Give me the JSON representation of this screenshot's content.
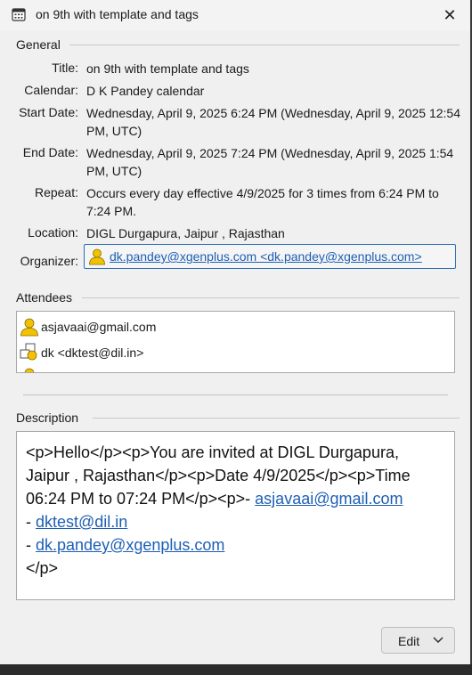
{
  "window": {
    "title": "on 9th with template and tags",
    "close_glyph": "✕"
  },
  "general": {
    "heading": "General",
    "title_label": "Title:",
    "title_value": "on 9th with template and tags",
    "calendar_label": "Calendar:",
    "calendar_value": "D K Pandey calendar",
    "start_label": "Start Date:",
    "start_value": "Wednesday, April 9, 2025 6:24 PM (Wednesday, April 9, 2025 12:54 PM, UTC)",
    "end_label": "End Date:",
    "end_value": "Wednesday, April 9, 2025 7:24 PM (Wednesday, April 9, 2025 1:54 PM, UTC)",
    "repeat_label": "Repeat:",
    "repeat_value": "Occurs every day effective 4/9/2025 for 3 times from 6:24 PM to 7:24 PM.",
    "location_label": "Location:",
    "location_value": "DIGL Durgapura, Jaipur , Rajasthan",
    "organizer_label": "Organizer:",
    "organizer_value": "dk.pandey@xgenplus.com <dk.pandey@xgenplus.com>"
  },
  "attendees": {
    "heading": "Attendees",
    "items": [
      {
        "label": "asjavaai@gmail.com",
        "icon": "person-icon"
      },
      {
        "label": "dk <dktest@dil.in>",
        "icon": "person-pending-icon"
      }
    ]
  },
  "description": {
    "heading": "Description",
    "line1": "<p>Hello</p><p>You are invited at DIGL Durgapura,",
    "line2": "Jaipur , Rajasthan</p><p>Date 4/9/2025</p><p>Time",
    "line3_text": "06:24 PM to 07:24 PM</p><p>- ",
    "line3_link": "asjavaai@gmail.com",
    "line4_prefix": "- ",
    "line4_link": "dktest@dil.in",
    "line5_prefix": "- ",
    "line5_link": "dk.pandey@xgenplus.com",
    "line6": "</p>"
  },
  "footer": {
    "edit_label": "Edit"
  },
  "colors": {
    "link": "#1d5fb4",
    "focus_border": "#2f6fb5",
    "person_icon": "#f2c200"
  }
}
